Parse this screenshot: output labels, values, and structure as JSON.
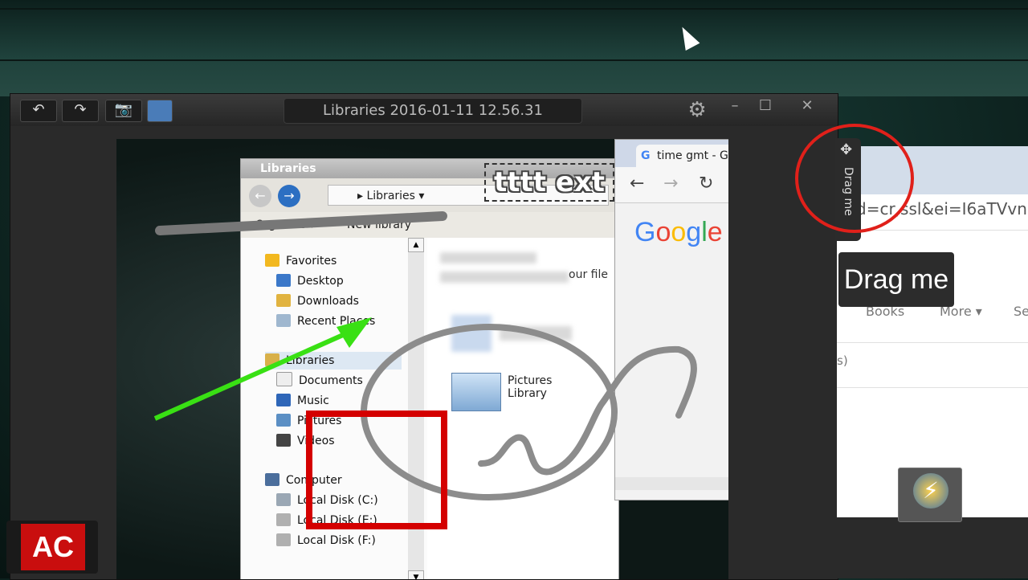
{
  "editor": {
    "title": "Libraries 2016-01-11 12.56.31",
    "toolbar": {
      "undo_icon": "undo-icon",
      "redo_icon": "redo-icon",
      "camera_icon": "camera-add-icon",
      "image_icon": "image-icon"
    },
    "window_controls": {
      "minimize": "–",
      "maximize": "☐",
      "close": "✕"
    }
  },
  "explorer": {
    "title": "Libraries",
    "address": "Libraries",
    "commands": {
      "organize": "Organize",
      "new_library": "New library"
    },
    "nav": {
      "favorites": "Favorites",
      "desktop": "Desktop",
      "downloads": "Downloads",
      "recent": "Recent Places",
      "libraries": "Libraries",
      "documents": "Documents",
      "music": "Music",
      "pictures": "Pictures",
      "videos": "Videos",
      "computer": "Computer",
      "disk_c": "Local Disk (C:)",
      "disk_e": "Local Disk (E:)",
      "disk_f": "Local Disk (F:)"
    },
    "content": {
      "partial_text": "our file",
      "pictures_library": "Pictures Library"
    }
  },
  "chrome": {
    "tab_title": "time gmt - G",
    "logo": "Google"
  },
  "annotations": {
    "text_label": "tttt ext",
    "arrow_color": "#39e014",
    "rect_color": "#d40000",
    "ellipse_color": "#8c8c8c"
  },
  "right_window": {
    "url_fragment": "d=cr,ssl&ei=I6aTVvn",
    "nav_books": "Books",
    "nav_more": "More ▾",
    "nav_se": "Se",
    "partial": "s)"
  },
  "drag": {
    "side_label": "Drag me",
    "tooltip": "Drag me"
  },
  "badge": {
    "text": "AC"
  }
}
